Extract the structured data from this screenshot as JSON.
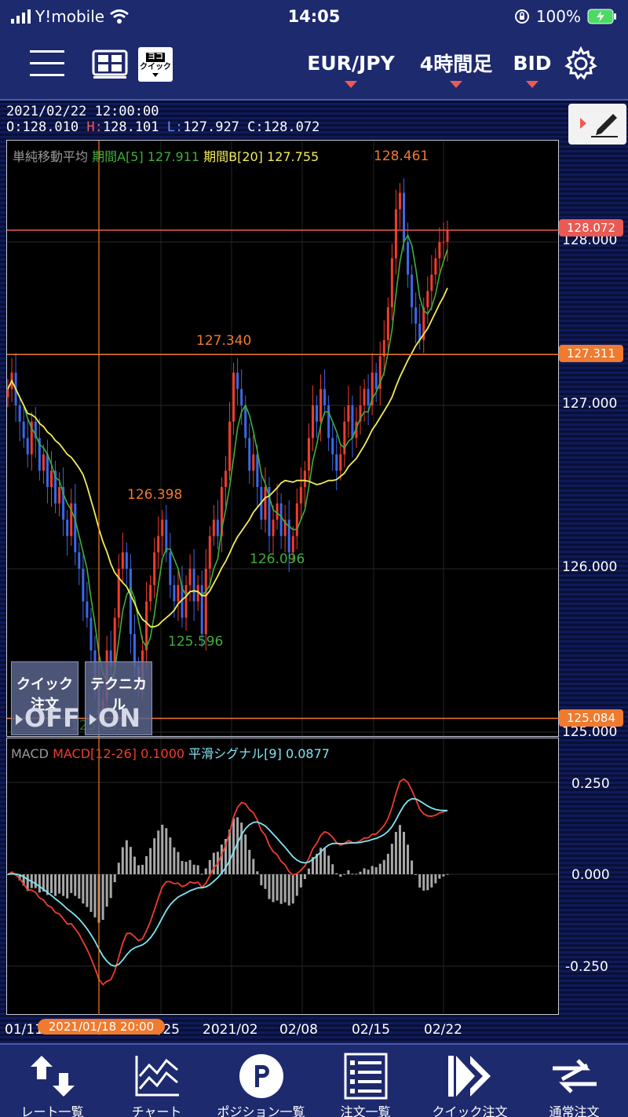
{
  "status": {
    "carrier": "Y!mobile",
    "time": "14:05",
    "battery": "100%"
  },
  "nav": {
    "menu_icon": "hamburger-icon",
    "layout_icon": "grid-layout-icon",
    "yoko_label": "ヨコ",
    "quick_label": "クイック",
    "symbol": "EUR/JPY",
    "timeframe": "4時間足",
    "price_type": "BID",
    "settings_icon": "gear-icon"
  },
  "chart": {
    "datetime": "2021/02/22  12:00:00",
    "o_label": "O:",
    "o_value": "128.010",
    "h_label": "H:",
    "h_value": "128.101",
    "l_label": "L:",
    "l_value": "127.927",
    "c_label": "C:",
    "c_value": "128.072",
    "sma_label": "単純移動平均",
    "sma_a": "期間A[5]",
    "sma_a_value": "127.911",
    "sma_b": "期間B[20]",
    "sma_b_value": "127.755",
    "macd_label": "MACD",
    "macd_param": "MACD[12-26]",
    "macd_value": "0.1000",
    "signal_param": "平滑シグナル[9]",
    "signal_value": "0.0877",
    "price_ticks": [
      "128.000",
      "127.000",
      "126.000",
      "125.000"
    ],
    "macd_ticks": [
      "0.250",
      "0.000",
      "-0.250"
    ],
    "tags": [
      "128.072",
      "127.311",
      "125.084"
    ],
    "annotations": [
      "128.461",
      "127.340",
      "126.398",
      "126.096",
      "125.596",
      "125.033"
    ],
    "x_labels": [
      "01/11",
      "01/18",
      "01/25",
      "2021/02",
      "02/08",
      "02/15",
      "02/22"
    ],
    "crosshair_date": "2021/01/18 20:00",
    "quick_order": {
      "title": "クイック注文",
      "state": "OFF"
    },
    "technical": {
      "title": "テクニカル",
      "state": "ON"
    },
    "colors": {
      "bull": "#f03c2e",
      "bear": "#3a68e8",
      "sma_a": "#3fae3c",
      "sma_b": "#f2ec5a",
      "macd": "#f03c2e",
      "signal": "#7fe6f2",
      "hist": "#a8a8a8",
      "line_tag": "#f07a2e"
    }
  },
  "chart_data": {
    "type": "candlestick",
    "symbol": "EUR/JPY",
    "timeframe": "4時間足",
    "x_ticks": [
      "01/11",
      "01/18",
      "01/25",
      "2021/02",
      "02/08",
      "02/15",
      "02/22"
    ],
    "ylim": [
      125.0,
      128.5
    ],
    "close": [
      127.1,
      127.2,
      127.0,
      126.9,
      126.8,
      126.7,
      126.9,
      126.8,
      126.6,
      126.7,
      126.5,
      126.6,
      126.4,
      126.5,
      126.3,
      126.2,
      126.4,
      126.1,
      126.0,
      125.8,
      125.7,
      125.5,
      125.3,
      125.1,
      125.2,
      125.5,
      125.4,
      125.7,
      126.0,
      126.1,
      126.0,
      125.6,
      125.4,
      125.3,
      125.5,
      125.8,
      125.9,
      126.1,
      126.2,
      126.3,
      126.1,
      125.9,
      125.8,
      125.9,
      125.7,
      125.9,
      126.0,
      125.8,
      125.9,
      125.6,
      126.0,
      126.2,
      126.3,
      126.2,
      126.5,
      126.6,
      126.9,
      127.2,
      127.1,
      127.0,
      126.8,
      126.6,
      126.7,
      126.5,
      126.3,
      126.5,
      126.2,
      126.3,
      126.4,
      126.2,
      126.3,
      126.1,
      126.2,
      126.4,
      126.5,
      126.6,
      126.8,
      127.0,
      126.9,
      127.1,
      127.0,
      126.8,
      126.7,
      126.6,
      126.7,
      126.9,
      127.0,
      126.8,
      126.9,
      127.0,
      127.1,
      127.0,
      127.2,
      127.1,
      127.3,
      127.4,
      127.6,
      127.9,
      128.2,
      128.3,
      128.0,
      127.8,
      127.6,
      127.5,
      127.4,
      127.6,
      127.7,
      127.8,
      127.9,
      128.0,
      128.0,
      128.07
    ],
    "sma_a": {
      "name": "期間A[5]",
      "last": 127.911
    },
    "sma_b": {
      "name": "期間B[20]",
      "last": 127.755
    },
    "levels": [
      128.072,
      127.311,
      125.084
    ],
    "high_annotations": [
      128.461,
      127.34,
      126.398
    ],
    "low_annotations": [
      126.096,
      125.596,
      125.033
    ],
    "macd": {
      "name": "MACD[12-26]",
      "last": 0.1,
      "signal_name": "平滑シグナル[9]",
      "signal_last": 0.0877,
      "ylim": [
        -0.35,
        0.3
      ]
    }
  },
  "tabs": [
    {
      "label": "レート一覧",
      "icon": "rate-list-icon"
    },
    {
      "label": "チャート",
      "icon": "chart-icon"
    },
    {
      "label": "ポジション一覧",
      "icon": "position-icon"
    },
    {
      "label": "注文一覧",
      "icon": "order-list-icon"
    },
    {
      "label": "クイック注文",
      "icon": "quick-order-icon"
    },
    {
      "label": "通常注文",
      "icon": "normal-order-icon"
    }
  ]
}
